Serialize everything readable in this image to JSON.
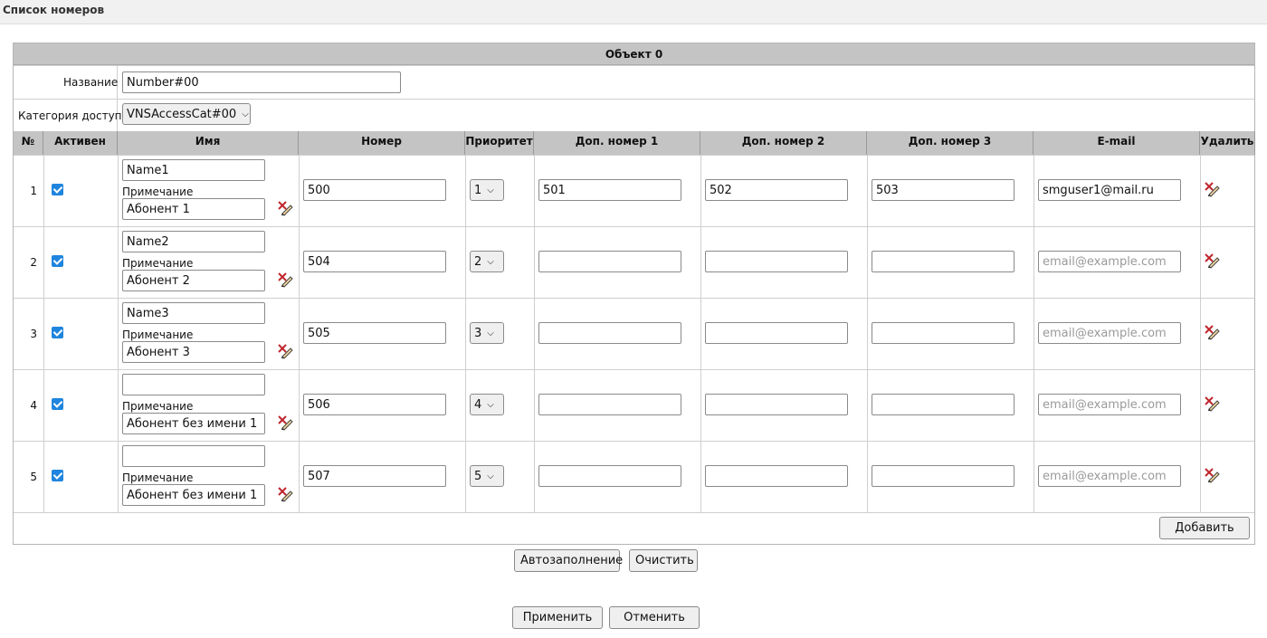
{
  "page": {
    "title": "Список номеров"
  },
  "object": {
    "header": "Объект 0",
    "name_label": "Название",
    "name_value": "Number#00",
    "category_label": "Категория доступа",
    "category_value": "VNSAccessCat#00"
  },
  "columns": [
    "№",
    "Активен",
    "Имя",
    "Номер",
    "Приоритет",
    "Доп. номер 1",
    "Доп. номер 2",
    "Доп. номер 3",
    "E-mail",
    "Удалить"
  ],
  "note_label": "Примечание",
  "email_placeholder": "email@example.com",
  "rows": [
    {
      "n": "1",
      "active": true,
      "name": "Name1",
      "note": "Абонент 1",
      "number": "500",
      "priority": "1",
      "extra1": "501",
      "extra2": "502",
      "extra3": "503",
      "email": "smguser1@mail.ru"
    },
    {
      "n": "2",
      "active": true,
      "name": "Name2",
      "note": "Абонент 2",
      "number": "504",
      "priority": "2",
      "extra1": "",
      "extra2": "",
      "extra3": "",
      "email": ""
    },
    {
      "n": "3",
      "active": true,
      "name": "Name3",
      "note": "Абонент 3",
      "number": "505",
      "priority": "3",
      "extra1": "",
      "extra2": "",
      "extra3": "",
      "email": ""
    },
    {
      "n": "4",
      "active": true,
      "name": "",
      "note": "Абонент без имени 1",
      "number": "506",
      "priority": "4",
      "extra1": "",
      "extra2": "",
      "extra3": "",
      "email": ""
    },
    {
      "n": "5",
      "active": true,
      "name": "",
      "note": "Абонент без имени 1",
      "number": "507",
      "priority": "5",
      "extra1": "",
      "extra2": "",
      "extra3": "",
      "email": ""
    }
  ],
  "buttons": {
    "add": "Добавить",
    "autofill": "Автозаполнение",
    "clear": "Очистить",
    "apply": "Применить",
    "cancel": "Отменить"
  },
  "colors": {
    "header_bg": "#c4c4c4",
    "checkbox": "#1f85de"
  }
}
